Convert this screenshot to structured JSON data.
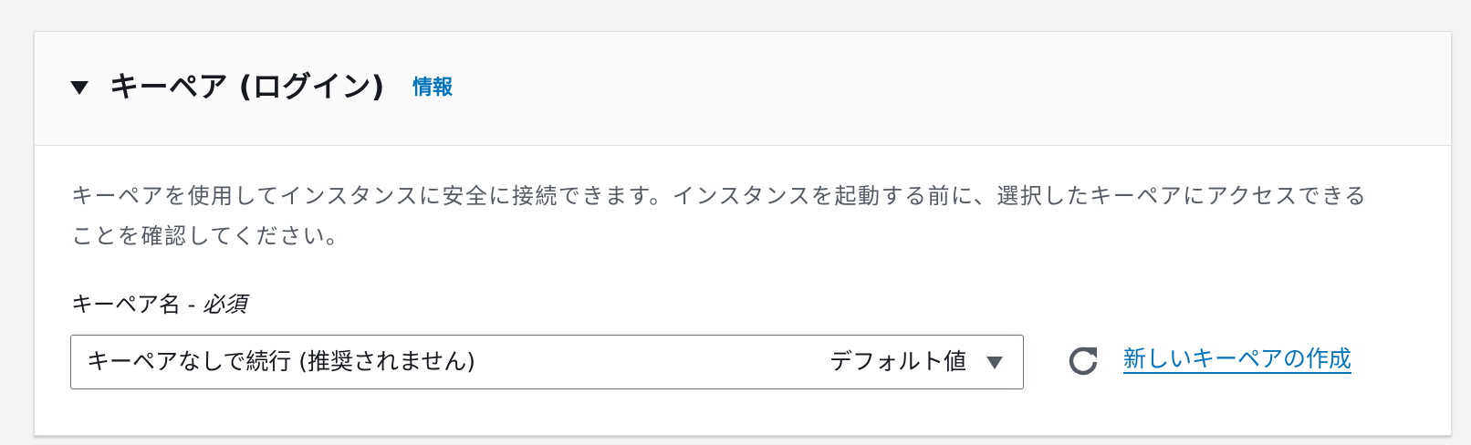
{
  "panel": {
    "title": "キーペア (ログイン)",
    "info_link": "情報",
    "caret_icon": "caret-down-icon",
    "description": "キーペアを使用してインスタンスに安全に接続できます。インスタンスを起動する前に、選択したキーペアにアクセスできることを確認してください。"
  },
  "field": {
    "label": "キーペア名 - ",
    "required": "必須",
    "select_value": "キーペアなしで続行 (推奨されません)",
    "select_tag": "デフォルト値",
    "select_caret_icon": "caret-down-icon",
    "refresh_icon": "refresh-icon",
    "create_link": "新しいキーペアの作成"
  },
  "colors": {
    "link": "#0073bb",
    "text": "#16191f",
    "secondary_text": "#545b64",
    "header_bg": "#fafafa",
    "page_bg": "#f2f3f3"
  }
}
